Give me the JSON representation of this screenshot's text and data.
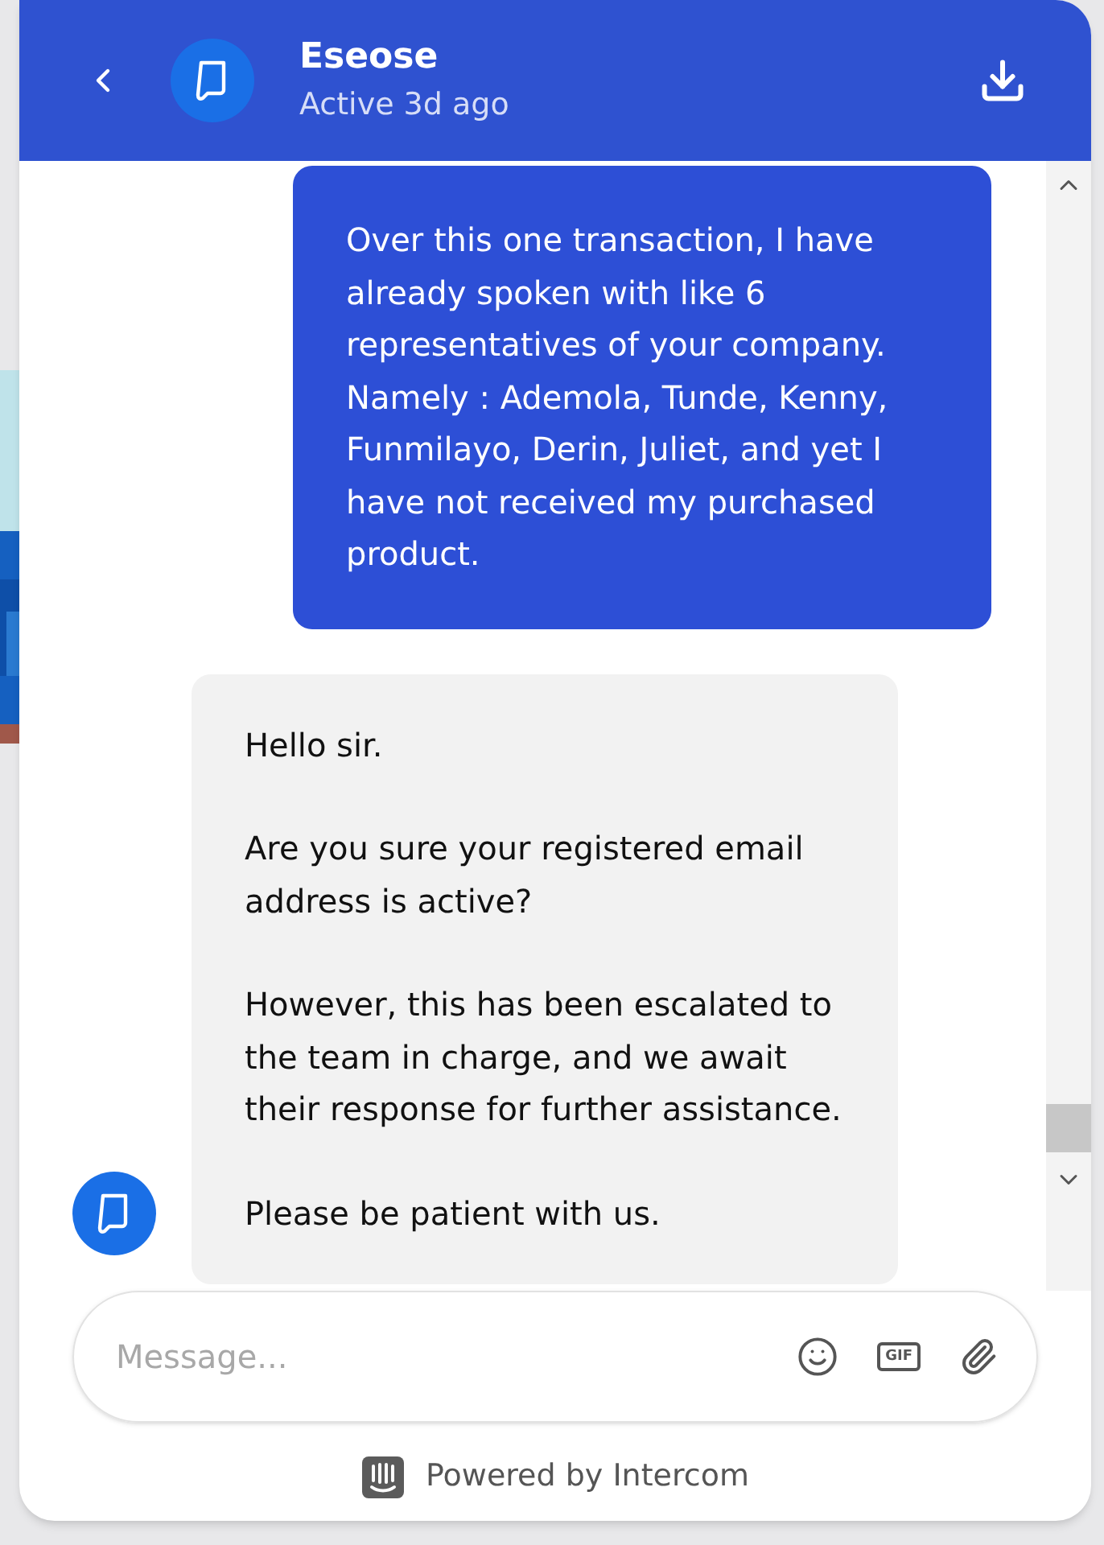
{
  "header": {
    "name": "Eseose",
    "status": "Active 3d ago"
  },
  "messages": [
    {
      "kind": "user",
      "paragraphs": [
        "Over this one transaction, I have already spoken with like 6 representatives of your company. Namely : Ademola, Tunde, Kenny, Funmilayo, Derin, Juliet, and yet I have not received my purchased product."
      ]
    },
    {
      "kind": "admin",
      "paragraphs": [
        "Hello sir.",
        "Are you sure your registered email address is active?",
        "However, this has been escalated to the team in charge, and we await their response for further assistance.",
        "Please be patient with us."
      ]
    }
  ],
  "composer": {
    "placeholder": "Message...",
    "gif_label": "GIF"
  },
  "footer": {
    "text": "Powered by Intercom"
  }
}
